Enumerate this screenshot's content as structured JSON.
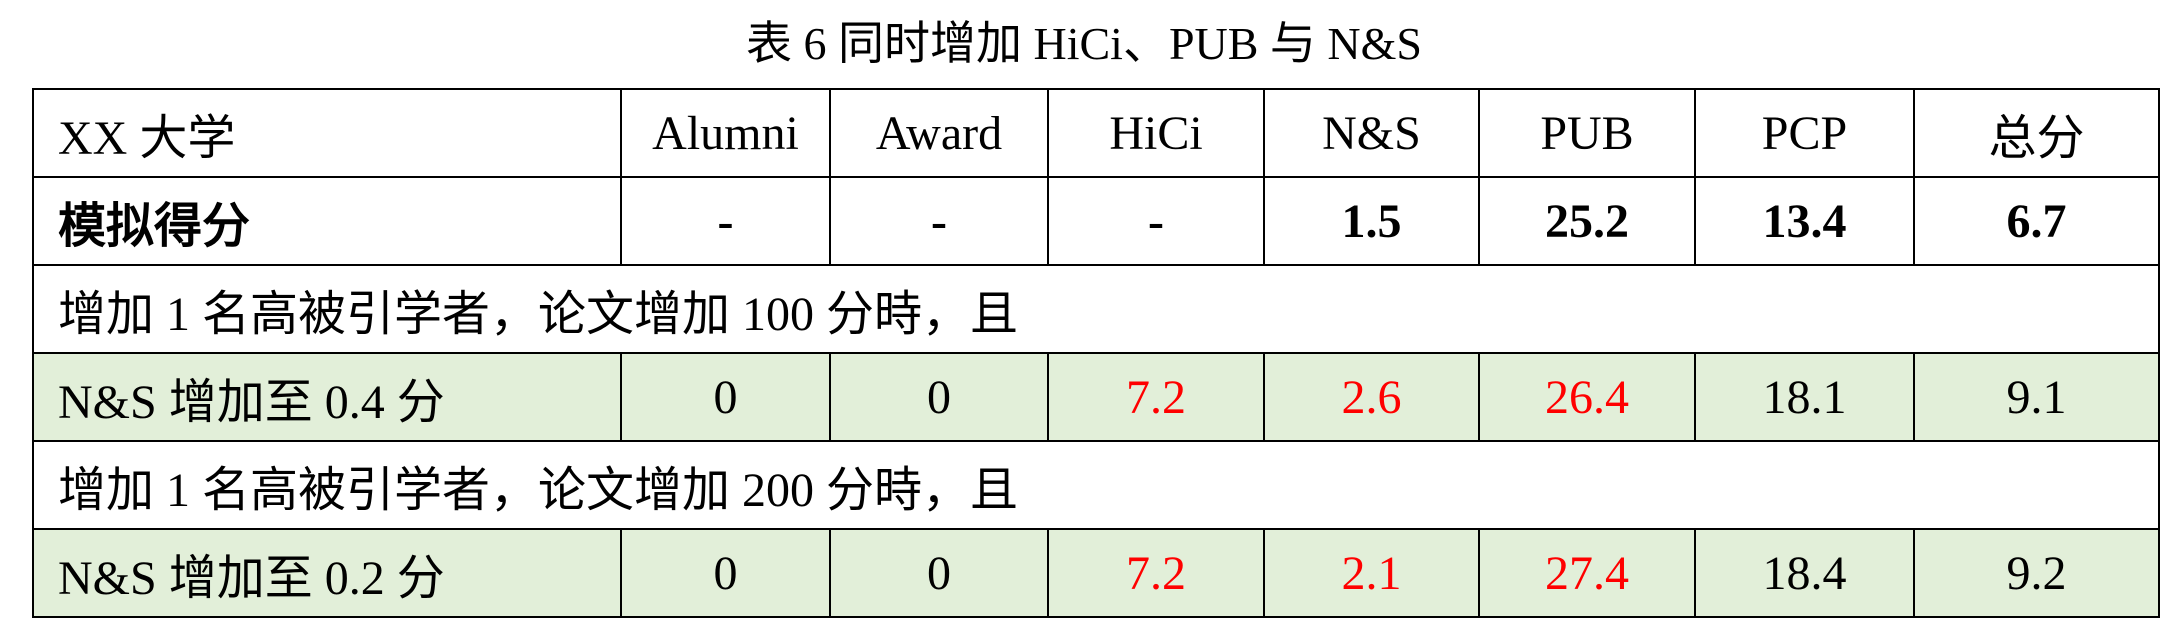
{
  "caption": "表 6 同时增加 HiCi、PUB 与 N&S",
  "header": {
    "row_label": "XX 大学",
    "columns": [
      "Alumni",
      "Award",
      "HiCi",
      "N&S",
      "PUB",
      "PCP",
      "总分"
    ]
  },
  "simulated": {
    "label": "模拟得分",
    "values": [
      "-",
      "-",
      "-",
      "1.5",
      "25.2",
      "13.4",
      "6.7"
    ]
  },
  "scenarios": [
    {
      "condition": "增加 1 名高被引学者，论文增加 100 分時，且",
      "label": "N&S 增加至 0.4 分",
      "values": [
        "0",
        "0",
        "7.2",
        "2.6",
        "26.4",
        "18.1",
        "9.1"
      ]
    },
    {
      "condition": "增加 1 名高被引学者，论文增加 200 分時，且",
      "label": "N&S 增加至 0.2 分",
      "values": [
        "0",
        "0",
        "7.2",
        "2.1",
        "27.4",
        "18.4",
        "9.2"
      ]
    }
  ],
  "colors": {
    "highlight_value": "#ff0000",
    "scenario_row_background": "#e2efd9"
  }
}
